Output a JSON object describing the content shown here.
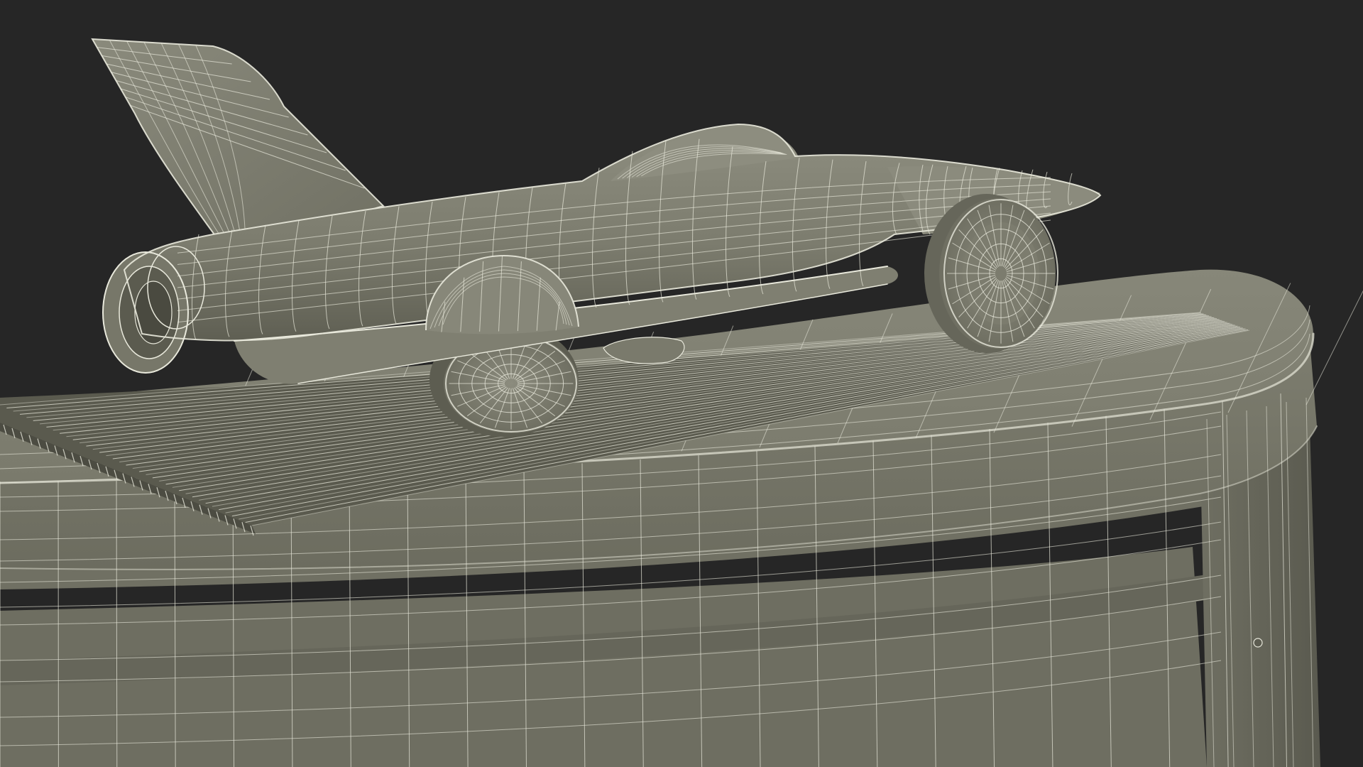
{
  "scene": {
    "subject": "jet-car-model-on-pedestal",
    "render_style": "wireframe-over-clay",
    "colors": {
      "background": "#262626",
      "clay_light": "#8a8a7c",
      "clay_mid": "#767668",
      "clay_dark": "#5e5e52",
      "clay_shadow": "#45453c",
      "wire": "#e9e9dc"
    }
  }
}
